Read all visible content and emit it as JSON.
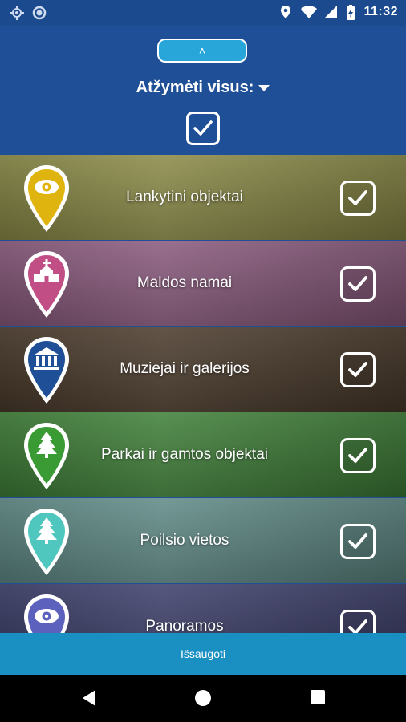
{
  "status_bar": {
    "time": "11:32",
    "left_icons": [
      "location-crosshair-icon",
      "circle-notification-icon"
    ],
    "right_icons": [
      "location-pin-icon",
      "wifi-icon",
      "signal-icon",
      "battery-charging-icon"
    ]
  },
  "header": {
    "collapse_label": "˄",
    "select_all_label": "Atžymėti visus:",
    "select_all_checked": true
  },
  "categories": [
    {
      "label": "Lankytini objektai",
      "icon": "eye-icon",
      "pin_color": "#e0b40f",
      "bg_color": "#8a8a47",
      "checked": true
    },
    {
      "label": "Maldos namai",
      "icon": "church-icon",
      "pin_color": "#c24e86",
      "bg_color": "#8a5a7d",
      "checked": true
    },
    {
      "label": "Muziejai ir galerijos",
      "icon": "museum-icon",
      "pin_color": "#1f4f96",
      "bg_color": "#4b3b2c",
      "checked": true
    },
    {
      "label": "Parkai ir gamtos objektai",
      "icon": "tree-icon",
      "pin_color": "#3a9a33",
      "bg_color": "#3f7f38",
      "checked": true
    },
    {
      "label": "Poilsio vietos",
      "icon": "tree-icon",
      "pin_color": "#4fc7bf",
      "bg_color": "#5f8a86",
      "checked": true
    },
    {
      "label": "Panoramos",
      "icon": "eye-icon",
      "pin_color": "#5c61bd",
      "bg_color": "#3c3e6a",
      "checked": true
    }
  ],
  "save_bar": {
    "label": "Išsaugoti"
  },
  "nav_bar": {
    "items": [
      "back-icon",
      "home-icon",
      "recents-icon"
    ]
  }
}
